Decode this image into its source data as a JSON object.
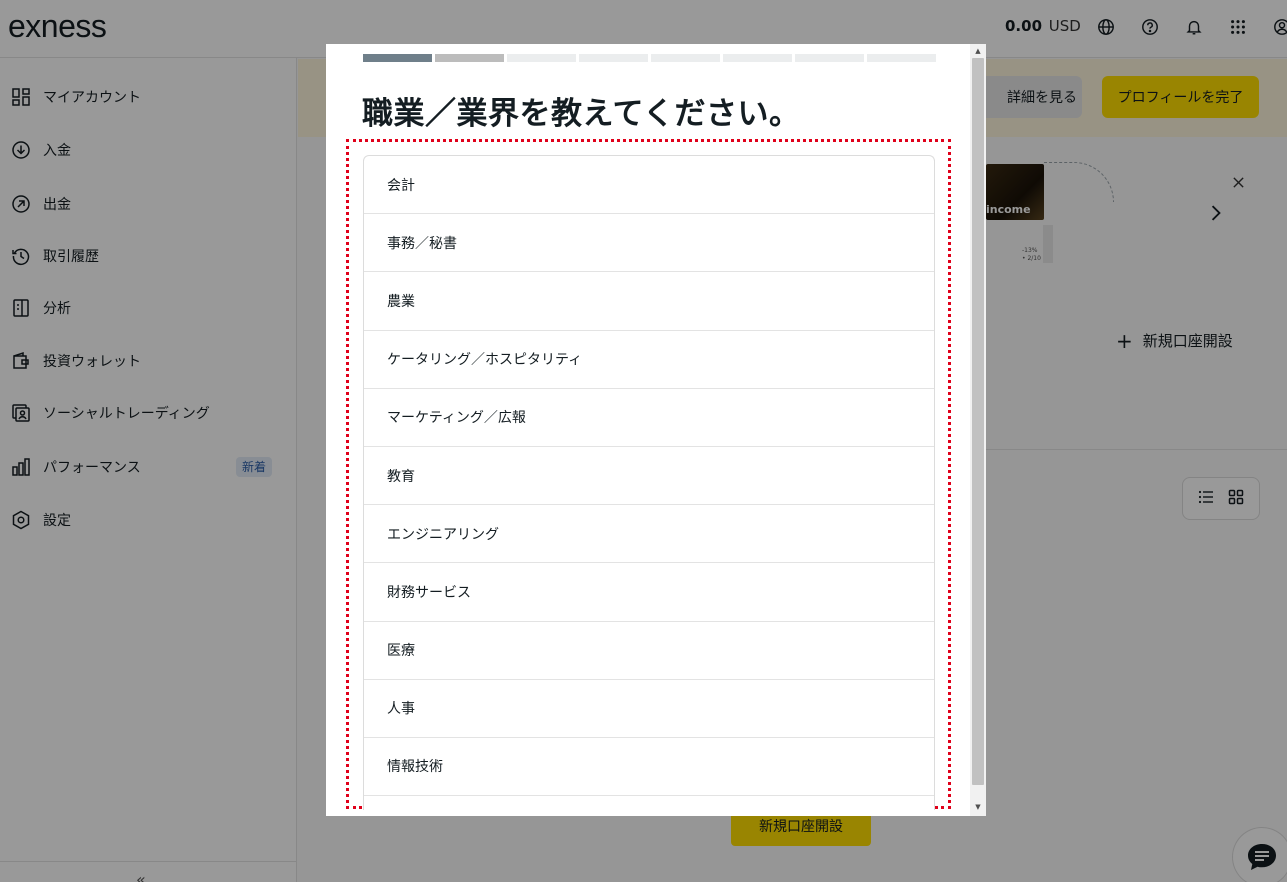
{
  "header": {
    "logo": "exness",
    "balance_value": "0.00",
    "balance_currency": "USD",
    "icons": [
      "globe-icon",
      "help-icon",
      "bell-icon",
      "apps-grid-icon",
      "account-icon"
    ]
  },
  "sidebar": {
    "items": [
      {
        "label": "マイアカウント",
        "icon": "dashboard-icon"
      },
      {
        "label": "入金",
        "icon": "deposit-icon"
      },
      {
        "label": "出金",
        "icon": "withdraw-icon"
      },
      {
        "label": "取引履歴",
        "icon": "history-icon"
      },
      {
        "label": "分析",
        "icon": "analytics-icon"
      },
      {
        "label": "投資ウォレット",
        "icon": "wallet-icon"
      },
      {
        "label": "ソーシャルトレーディング",
        "icon": "social-trading-icon"
      },
      {
        "label": "パフォーマンス",
        "icon": "performance-icon",
        "badge": "新着"
      },
      {
        "label": "設定",
        "icon": "settings-icon"
      }
    ]
  },
  "banner": {
    "details_label": "詳細を見る",
    "complete_label": "プロフィールを完了"
  },
  "promo": {
    "image_text": "income",
    "small_text_1": "-13%",
    "small_text_2": "• 2/10"
  },
  "main": {
    "new_account_link": "新規口座開設",
    "open_account_button": "新規口座開設"
  },
  "modal": {
    "title": "職業／業界を教えてください。",
    "progress": {
      "total": 8,
      "completed": 1,
      "current": 2
    },
    "options": [
      "会計",
      "事務／秘書",
      "農業",
      "ケータリング／ホスピタリティ",
      "マーケティング／広報",
      "教育",
      "エンジニアリング",
      "財務サービス",
      "医療",
      "人事",
      "情報技術"
    ]
  },
  "colors": {
    "accent_yellow": "#ffde02",
    "banner_bg": "#fdf6dd",
    "highlight_red": "#e0001a",
    "progress_done": "#6f7f8a"
  }
}
